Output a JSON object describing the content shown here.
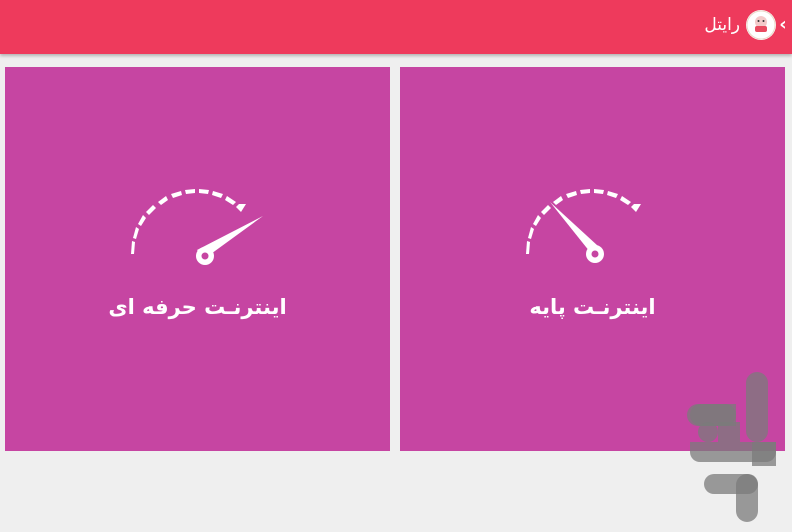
{
  "appbar": {
    "title": "رایتل",
    "background_color": "#ee3a5c",
    "back_icon": "chevron-left-icon",
    "logo_icon": "app-logo-icon"
  },
  "tiles": [
    {
      "label": "اینترنـت پایه",
      "icon": "speedometer-low-icon",
      "color": "#c645a2"
    },
    {
      "label": "اینترنـت حرفه ای",
      "icon": "speedometer-high-icon",
      "color": "#c645a2"
    }
  ],
  "watermark": {
    "icon": "bazaar-logo-icon"
  }
}
